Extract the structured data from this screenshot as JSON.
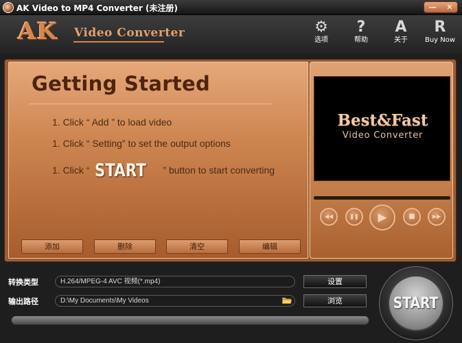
{
  "window": {
    "title": "AK Video to MP4 Converter (未注册)",
    "minimize_glyph": "—",
    "close_glyph": "✕"
  },
  "header": {
    "logo_ak": "AK",
    "logo_subtitle": "Video Converter",
    "tools": [
      {
        "icon": "gear-icon",
        "glyph": "⚙",
        "label": "选项"
      },
      {
        "icon": "question-icon",
        "glyph": "?",
        "label": "帮助"
      },
      {
        "icon": "about-icon",
        "glyph": "A",
        "label": "关于"
      },
      {
        "icon": "register-icon",
        "glyph": "R",
        "label": "Buy Now"
      }
    ]
  },
  "guide": {
    "title": "Getting Started",
    "step1": "1. Click “ Add ” to load video",
    "step2": "1. Click “ Setting” to set the output options",
    "step3_prefix": "1. Click “",
    "step3_start": "START",
    "step3_suffix": "” button to start converting",
    "buttons": [
      "添加",
      "删除",
      "清空",
      "编辑"
    ]
  },
  "player": {
    "screen_line1": "Best&Fast",
    "screen_line2": "Video Converter",
    "controls": [
      {
        "icon": "rewind-icon",
        "glyph": "◀◀"
      },
      {
        "icon": "pause-icon",
        "glyph": "❚❚"
      },
      {
        "icon": "play-icon",
        "glyph": "▶"
      },
      {
        "icon": "stop-icon",
        "glyph": "■"
      },
      {
        "icon": "fast-forward-icon",
        "glyph": "▶▶"
      }
    ]
  },
  "output": {
    "format_label": "转换类型",
    "format_value": "H.264/MPEG-4 AVC 视频(*.mp4)",
    "settings_button": "设置",
    "path_label": "输出路径",
    "path_value": "D:\\My Documents\\My Videos",
    "browse_button": "浏览",
    "start_button": "START"
  },
  "colors": {
    "accent": "#c77a46",
    "panel": "#9a5d36",
    "background": "#1e1e1e"
  }
}
